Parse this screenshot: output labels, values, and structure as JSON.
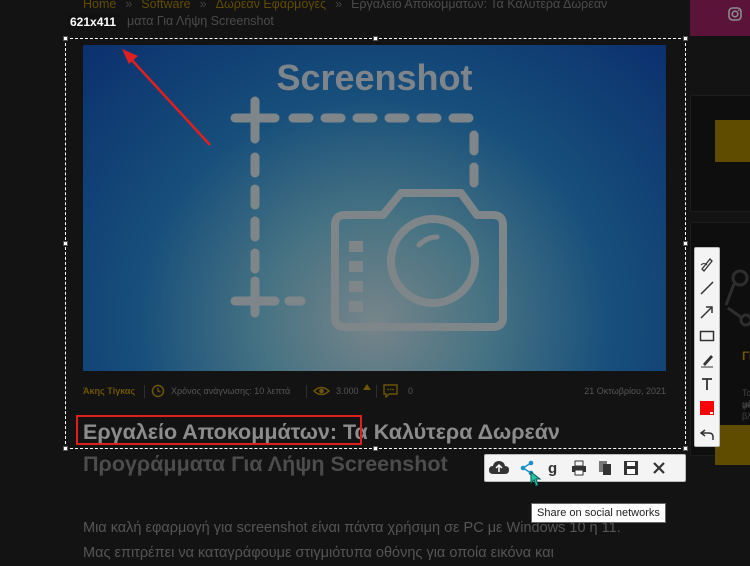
{
  "breadcrumb": {
    "home": "Home",
    "sep": "»",
    "software": "Software",
    "free_apps": "Δωρεάν Εφαρμογές",
    "current_line1": "Εργαλείο Αποκομμάτων: Τα Καλύτερα Δωρεάν",
    "current_line2": "ματα Για Λήψη Screenshot"
  },
  "selection": {
    "size_label": "621x411"
  },
  "hero": {
    "title": "Screenshot"
  },
  "article": {
    "author": "Άκης Τίγκας",
    "reading_time": "Χρόνος ανάγνωσης: 10 λεπτά",
    "views": "3.000",
    "comments": "0",
    "date": "21 Οκτωβρίου, 2021",
    "title_highlight": "Εργαλείο Αποκομμάτων:",
    "title_rest": " Τα Καλύτερα Δωρεάν",
    "title_line2": "Προγράμματα Για Λήψη Screenshot",
    "body_line1": "Μια καλή εφαρμογή για screenshot είναι πάντα χρήσιμη σε PC με Windows 10 ή 11.",
    "body_line2": "Μας επιτρέπει να καταγράφουμε στιγμιότυπα οθόνης για οποία εικόνα και"
  },
  "sidebar": {
    "heading_partial": "Γίνε",
    "small1": "Τα μέλ",
    "small2": "φεν βλ"
  },
  "tooltip": {
    "text": "Share on social networks"
  },
  "colors": {
    "accent": "#b08a00",
    "annotation": "#e02020",
    "color_swatch": "#ff0000"
  }
}
